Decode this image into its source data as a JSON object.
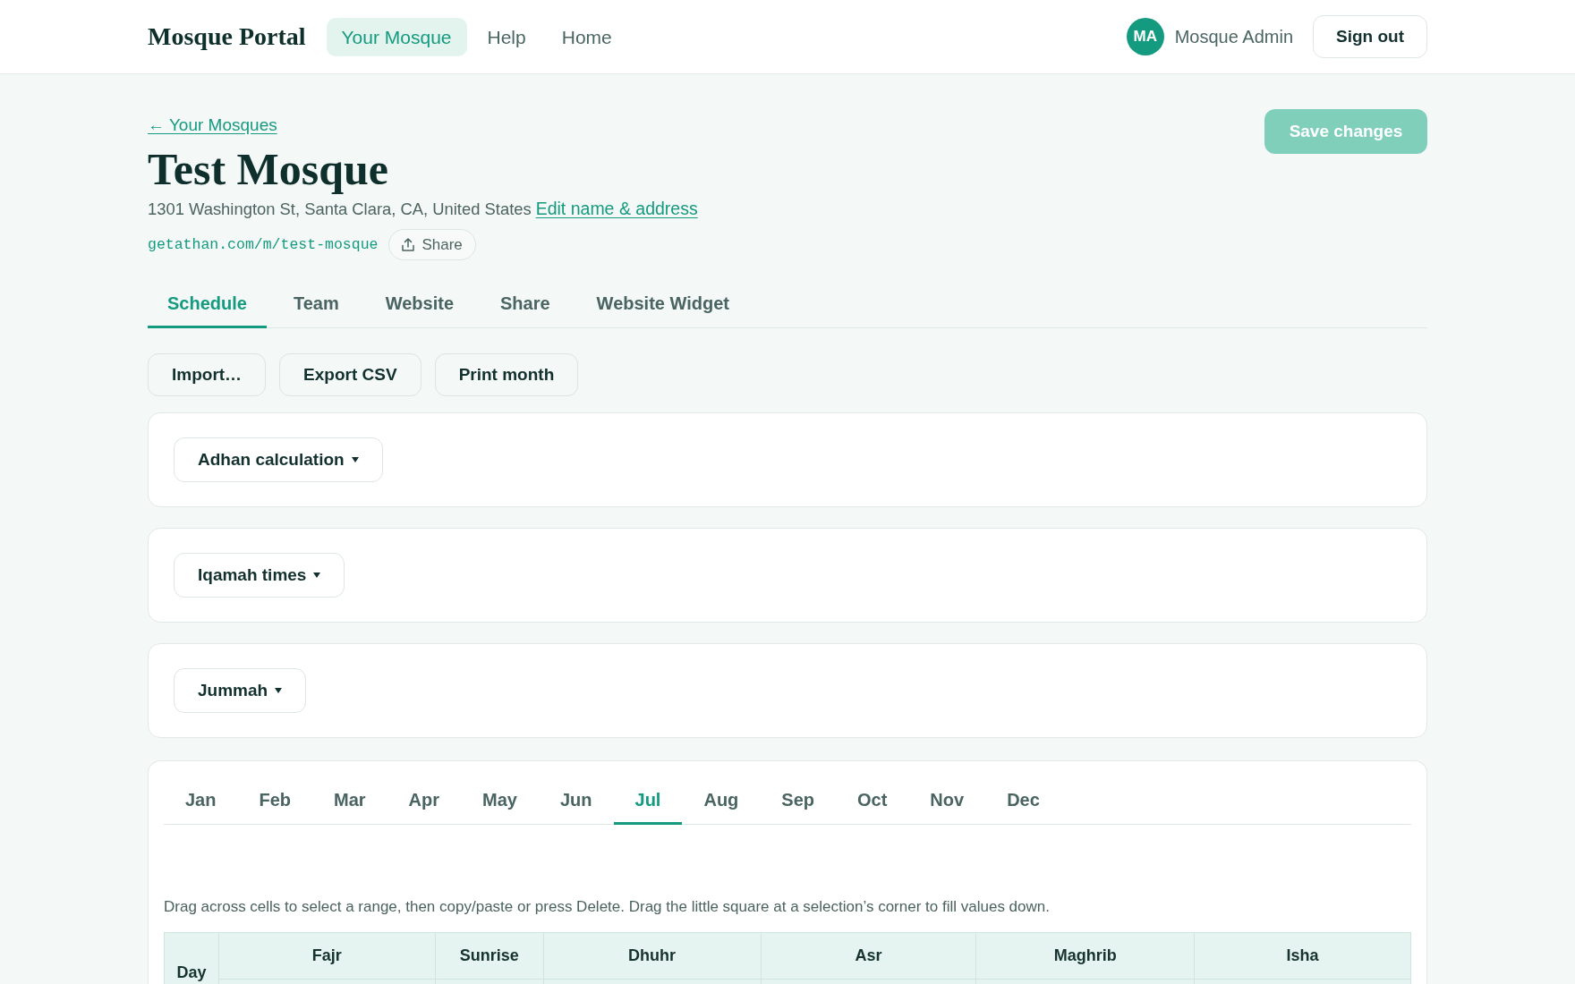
{
  "header": {
    "logo": "Mosque Portal",
    "nav": [
      {
        "label": "Your Mosque",
        "selected": true
      },
      {
        "label": "Help",
        "selected": false
      },
      {
        "label": "Home",
        "selected": false
      }
    ],
    "user": {
      "initials": "MA",
      "name": "Mosque Admin"
    },
    "sign_out": "Sign out"
  },
  "mosque": {
    "back_link": "← Your Mosques",
    "title": "Test Mosque",
    "address": "1301 Washington St, Santa Clara, CA, United States",
    "edit_link": "Edit name & address",
    "url": "getathan.com/m/test-mosque",
    "share_button": "Share"
  },
  "save_button": {
    "label": "Save changes",
    "disabled": true
  },
  "tabs": [
    {
      "label": "Schedule",
      "selected": true
    },
    {
      "label": "Team",
      "selected": false
    },
    {
      "label": "Website",
      "selected": false
    },
    {
      "label": "Share",
      "selected": false
    },
    {
      "label": "Website Widget",
      "selected": false
    }
  ],
  "actions": [
    "Import…",
    "Export CSV",
    "Print month"
  ],
  "sections": [
    {
      "label": "Adhan calculation"
    },
    {
      "label": "Iqamah times"
    },
    {
      "label": "Jummah"
    }
  ],
  "months": [
    {
      "label": "Jan",
      "selected": false
    },
    {
      "label": "Feb",
      "selected": false
    },
    {
      "label": "Mar",
      "selected": false
    },
    {
      "label": "Apr",
      "selected": false
    },
    {
      "label": "May",
      "selected": false
    },
    {
      "label": "Jun",
      "selected": false
    },
    {
      "label": "Jul",
      "selected": true
    },
    {
      "label": "Aug",
      "selected": false
    },
    {
      "label": "Sep",
      "selected": false
    },
    {
      "label": "Oct",
      "selected": false
    },
    {
      "label": "Nov",
      "selected": false
    },
    {
      "label": "Dec",
      "selected": false
    }
  ],
  "hint": "Drag across cells to select a range, then copy/paste or press Delete. Drag the little square at a selection’s corner to fill values down.",
  "table": {
    "columns": [
      "Day",
      "Fajr",
      "Sunrise",
      "Dhuhr",
      "Asr",
      "Maghrib",
      "Isha"
    ]
  }
}
